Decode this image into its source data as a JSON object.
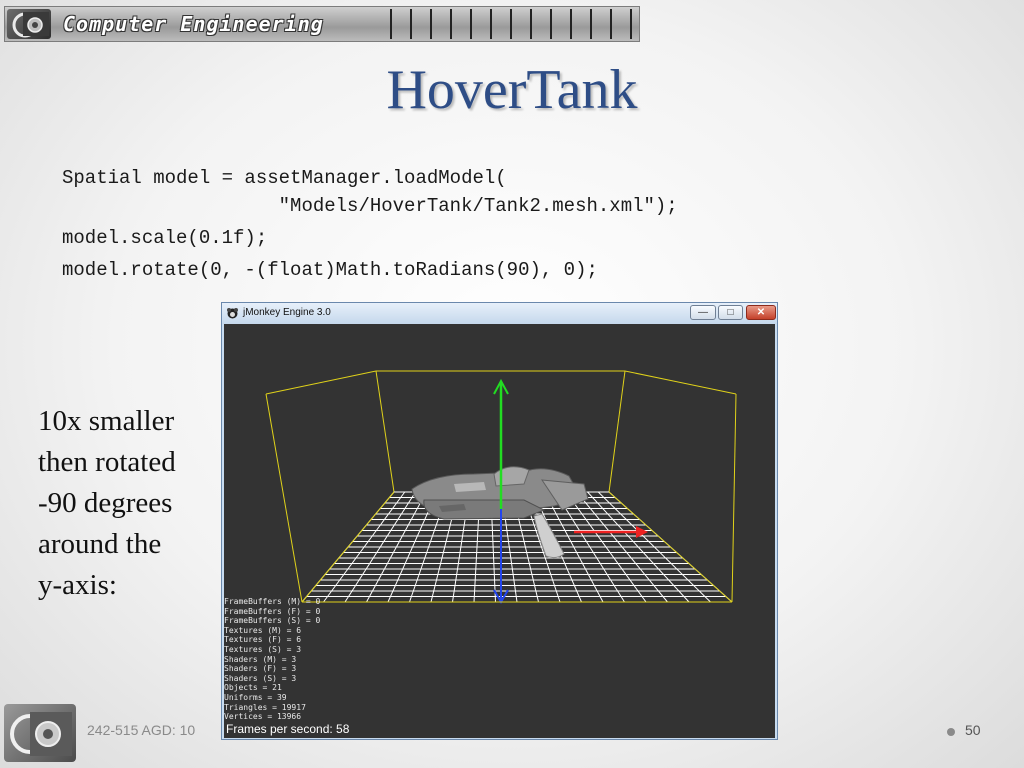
{
  "header": {
    "banner_title": "Computer Engineering",
    "logo_icon": "gear-logo-icon"
  },
  "slide": {
    "title": "HoverTank",
    "code_lines": [
      "Spatial model = assetManager.loadModel(",
      "                   \"Models/HoverTank/Tank2.mesh.xml\");",
      "model.scale(0.1f);",
      "model.rotate(0, -(float)Math.toRadians(90), 0);"
    ],
    "caption_lines": [
      "10x smaller",
      "then rotated",
      "-90 degrees",
      "around the",
      "y-axis:"
    ]
  },
  "window": {
    "title": "jMonkey Engine 3.0",
    "app_icon": "jmonkey-icon",
    "buttons": {
      "minimize": "minimize-icon",
      "maximize": "maximize-icon",
      "close": "close-icon"
    },
    "stats": [
      "FrameBuffers (M) = 0",
      "FrameBuffers (F) = 0",
      "FrameBuffers (S) = 0",
      "Textures (M) = 6",
      "Textures (F) = 6",
      "Textures (S) = 3",
      "Shaders (M) = 3",
      "Shaders (F) = 3",
      "Shaders (S) = 3",
      "Objects = 21",
      "Uniforms = 39",
      "Triangles = 19917",
      "Vertices = 13966"
    ],
    "fps": "Frames per second: 58",
    "colors": {
      "box": "#e0d21a",
      "grid": "#ffffff",
      "axis_y": "#22dd22",
      "axis_x": "#ee2222",
      "axis_z": "#2244ee",
      "background": "#333333"
    }
  },
  "footer": {
    "course_text": "242-515 AGD: 10",
    "page_number": "50"
  }
}
